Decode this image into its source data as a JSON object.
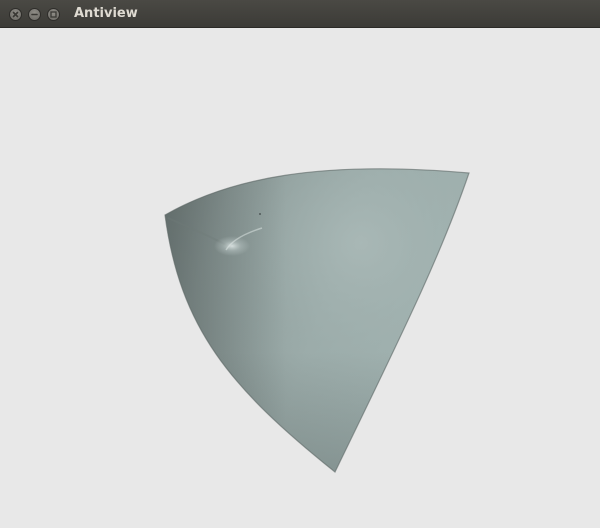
{
  "window": {
    "title": "Antiview",
    "buttons": [
      {
        "name": "close",
        "icon": "close-icon"
      },
      {
        "name": "minimize",
        "icon": "minimize-icon"
      },
      {
        "name": "maximize",
        "icon": "maximize-icon"
      }
    ]
  },
  "viewport": {
    "background": "#e8e8e8",
    "object": {
      "shape": "curved-triangular-surface",
      "color": "#93a5a3"
    }
  }
}
